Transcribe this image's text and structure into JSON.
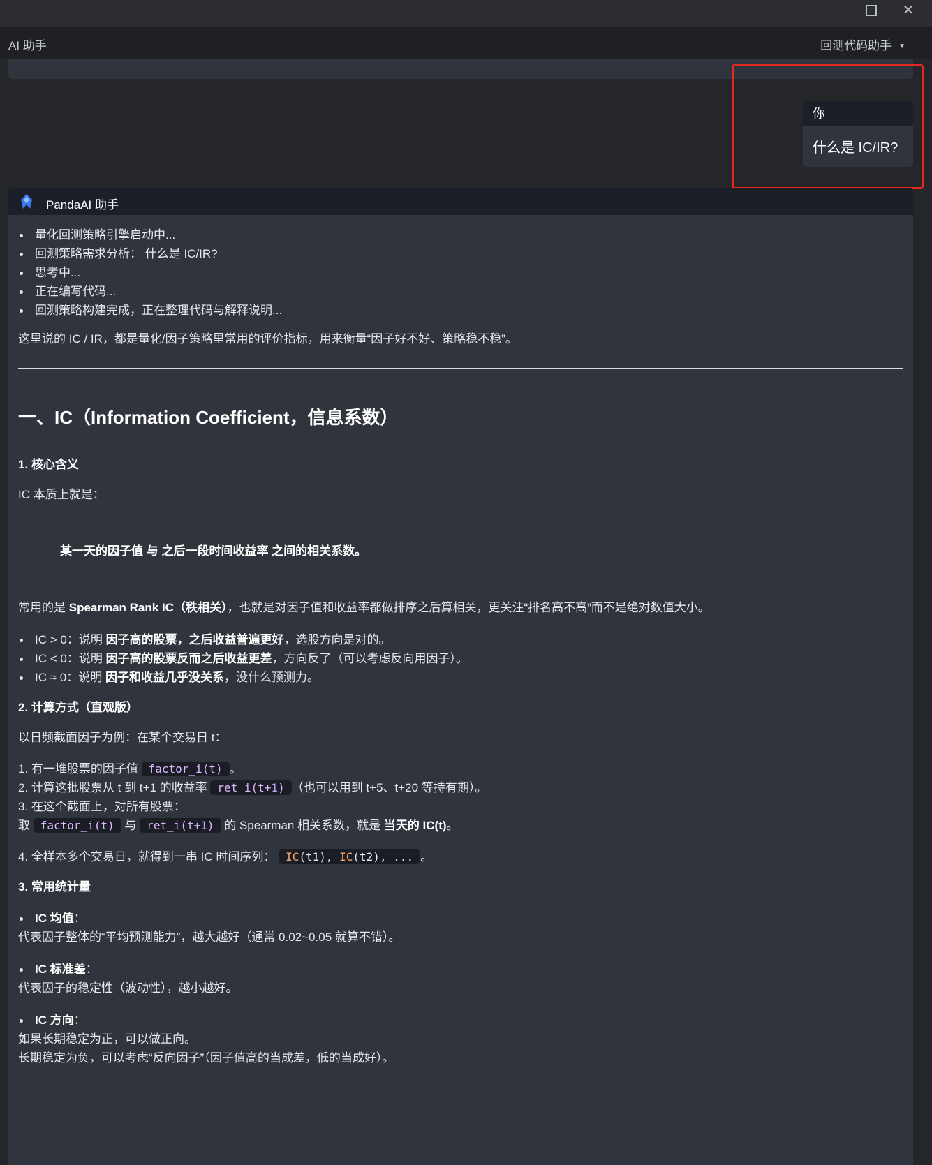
{
  "window": {
    "maximize_icon": "maximize-icon",
    "close_icon": "close-icon"
  },
  "header": {
    "title": "AI 助手",
    "assistant_label": "回测代码助手",
    "chevron_icon": "chevron-down-icon"
  },
  "user_message": {
    "sender": "你",
    "text": "什么是 IC/IR?"
  },
  "ai_message": {
    "sender": "PandaAI 助手",
    "logo_icon": "pandaai-logo-icon",
    "status_steps": [
      "量化回测策略引擎启动中...",
      "回测策略需求分析： 什么是 IC/IR?",
      "思考中...",
      "正在编写代码...",
      "回测策略构建完成，正在整理代码与解释说明..."
    ],
    "intro": "这里说的 IC / IR，都是量化/因子策略里常用的评价指标，用来衡量“因子好不好、策略稳不稳”。",
    "section1_title": "一、IC（Information Coefficient，信息系数）",
    "sub1_title": "1. 核心含义",
    "sub1_lead": "IC 本质上就是：",
    "sub1_quote": "某一天的因子值 与 之后一段时间收益率 之间的相关系数。",
    "spearman": {
      "pre": "常用的是 ",
      "bold": "Spearman Rank IC（秩相关）",
      "post": "，也就是对因子值和收益率都做排序之后算相关，更关注“排名高不高”而不是绝对数值大小。"
    },
    "ic_cases": [
      {
        "pre": "IC > 0：说明 ",
        "bold": "因子高的股票，之后收益普遍更好",
        "post": "，选股方向是对的。"
      },
      {
        "pre": "IC < 0：说明 ",
        "bold": "因子高的股票反而之后收益更差",
        "post": "，方向反了（可以考虑反向用因子）。"
      },
      {
        "pre": "IC ≈ 0：说明 ",
        "bold": "因子和收益几乎没关系",
        "post": "，没什么预测力。"
      }
    ],
    "sub2_title": "2. 计算方式（直观版）",
    "sub2_lead": "以日频截面因子为例：在某个交易日 t：",
    "steps": {
      "s1_pre": "1. 有一堆股票的因子值 ",
      "s1_code": "factor_i(t)",
      "s1_post": "。",
      "s2_pre": "2. 计算这批股票从 t 到 t+1 的收益率 ",
      "s2_code_a": "ret_i(t+",
      "s2_code_num": "1",
      "s2_code_b": ")",
      "s2_post": "（也可以用到 t+5、t+20 等持有期）。",
      "s3": "3. 在这个截面上，对所有股票：",
      "s3b_pre": "取 ",
      "s3b_code1": "factor_i(t)",
      "s3b_mid": " 与 ",
      "s3b_code2_a": "ret_i(t+",
      "s3b_code2_num": "1",
      "s3b_code2_b": ")",
      "s3b_post": " 的 Spearman 相关系数，就是 ",
      "s3b_bold": "当天的 IC(t)",
      "s3b_end": "。",
      "s4_pre": "4. 全样本多个交易日，就得到一串 IC 时间序列： ",
      "s4_fn1": "IC",
      "s4_c1": "(t1), ",
      "s4_fn2": "IC",
      "s4_c2": "(t2), ...",
      "s4_post": "。"
    },
    "sub3_title": "3. 常用统计量",
    "stats": [
      {
        "label": "IC 均值",
        "colon": "：",
        "desc": "代表因子整体的“平均预测能力”，越大越好（通常 0.02~0.05 就算不错）。"
      },
      {
        "label": "IC 标准差",
        "colon": "：",
        "desc": "代表因子的稳定性（波动性），越小越好。"
      },
      {
        "label": "IC 方向",
        "colon": "：",
        "desc": "如果长期稳定为正，可以做正向。",
        "desc2": "长期稳定为负，可以考虑“反向因子”（因子值高的当成差，低的当成好）。"
      }
    ]
  }
}
